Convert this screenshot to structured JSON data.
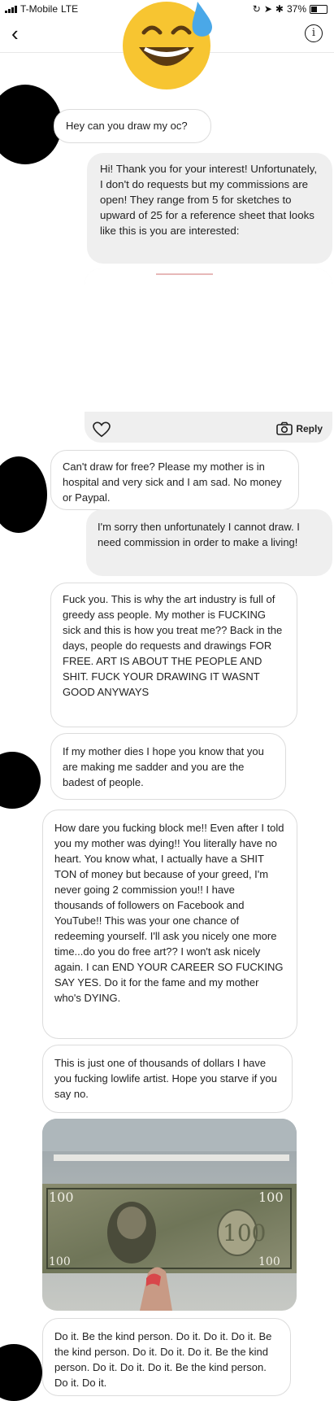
{
  "status_bar": {
    "carrier": "T-Mobile",
    "network": "LTE",
    "battery": "37%"
  },
  "messages": [
    {
      "id": "m1",
      "sender": "them",
      "text": "Hey can you draw my oc?"
    },
    {
      "id": "m2",
      "sender": "me",
      "text": "Hi! Thank you for your interest! Unfortunately, I don't do requests but my commissions are open! They range from 5 for sketches to upward of 25 for a reference sheet that looks like this is you are interested:"
    },
    {
      "id": "m3",
      "sender": "them",
      "text": "Can't draw for free? Please my mother is in hospital and very sick and I am sad. No money or Paypal."
    },
    {
      "id": "m4",
      "sender": "me",
      "text": "I'm sorry then unfortunately I cannot draw. I need commission in order to make a living!"
    },
    {
      "id": "m5",
      "sender": "them",
      "text": "Fuck you. This is why the art industry is full of greedy ass people. My mother is FUCKING sick and this is how you treat me?? Back in the days, people do requests and drawings FOR FREE. ART IS ABOUT THE PEOPLE AND SHIT. FUCK YOUR DRAWING IT WASNT GOOD ANYWAYS"
    },
    {
      "id": "m6",
      "sender": "them",
      "text": "If my mother dies I hope you know that you are making me sadder and you are the badest of people."
    },
    {
      "id": "m7",
      "sender": "them",
      "text": "How dare you fucking block me!! Even after I told you my mother was dying!! You literally have no heart. You know what, I actually have a SHIT TON of money but because of your greed, I'm never going 2 commission you!! I have thousands of followers on Facebook and YouTube!! This was your one chance of redeeming yourself. I'll ask you nicely one more time...do you do free art?? I won't ask nicely again. I can END YOUR CAREER SO FUCKING SAY YES. Do it for the fame and my mother who's DYING."
    },
    {
      "id": "m8",
      "sender": "them",
      "text": "This is just one of thousands of dollars I have you fucking lowlife artist. Hope you starve if you say no."
    },
    {
      "id": "m9",
      "sender": "them",
      "text": "Do it. Be the kind person. Do it. Do it. Do it. Be the kind person. Do it. Do it. Do it. Be the kind person. Do it. Do it. Do it. Be the kind person. Do it. Do it."
    }
  ],
  "shared_media": {
    "reply_label": "Reply"
  },
  "photo": {
    "bill_text": "100"
  },
  "colors": {
    "my_bubble": "#efefef",
    "their_bubble_border": "#dcdcdc",
    "avatar": "#000000",
    "emoji": "#f7c531",
    "sweat_drop": "#4aa8e8"
  }
}
